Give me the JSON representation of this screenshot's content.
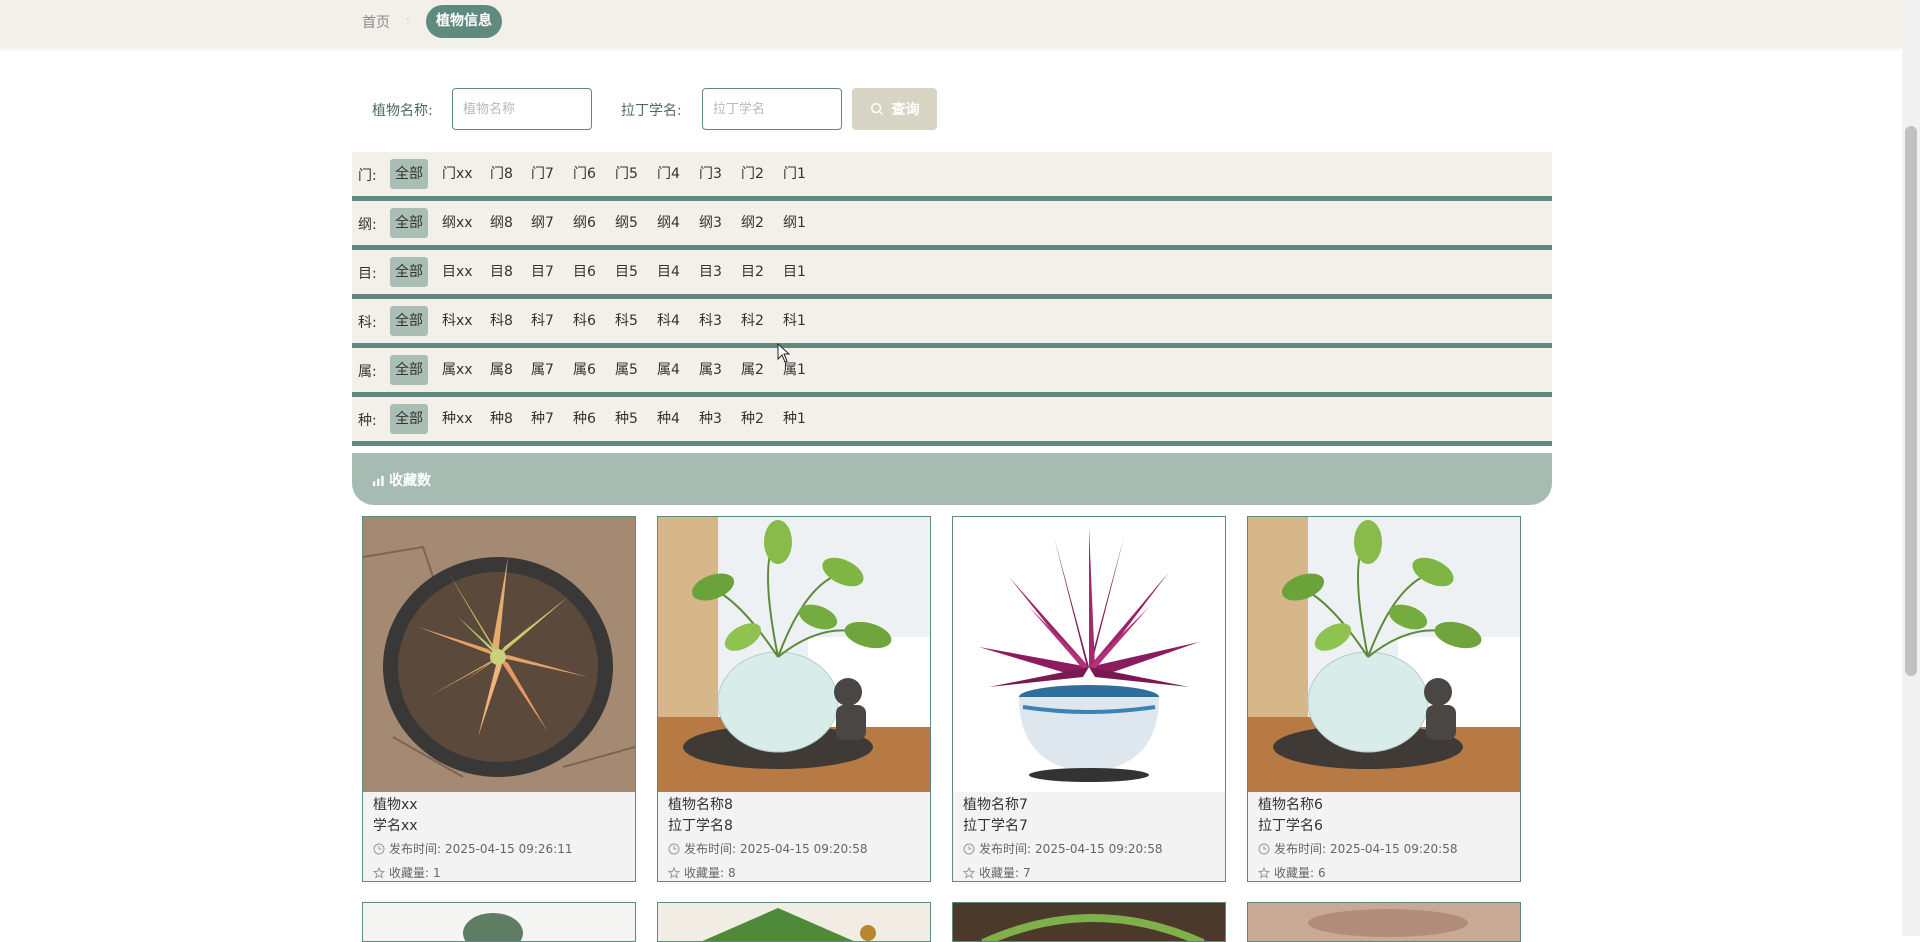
{
  "breadcrumb": {
    "home": "首页",
    "separator": "·",
    "current": "植物信息"
  },
  "search": {
    "name_label": "植物名称:",
    "name_placeholder": "植物名称",
    "latin_label": "拉丁学名:",
    "latin_placeholder": "拉丁学名",
    "query_label": "查询"
  },
  "filters": [
    {
      "label": "门:",
      "options": [
        "全部",
        "门xx",
        "门8",
        "门7",
        "门6",
        "门5",
        "门4",
        "门3",
        "门2",
        "门1"
      ],
      "active": 0
    },
    {
      "label": "纲:",
      "options": [
        "全部",
        "纲xx",
        "纲8",
        "纲7",
        "纲6",
        "纲5",
        "纲4",
        "纲3",
        "纲2",
        "纲1"
      ],
      "active": 0
    },
    {
      "label": "目:",
      "options": [
        "全部",
        "目xx",
        "目8",
        "目7",
        "目6",
        "目5",
        "目4",
        "目3",
        "目2",
        "目1"
      ],
      "active": 0
    },
    {
      "label": "科:",
      "options": [
        "全部",
        "科xx",
        "科8",
        "科7",
        "科6",
        "科5",
        "科4",
        "科3",
        "科2",
        "科1"
      ],
      "active": 0
    },
    {
      "label": "属:",
      "options": [
        "全部",
        "属xx",
        "属8",
        "属7",
        "属6",
        "属5",
        "属4",
        "属3",
        "属2",
        "属1"
      ],
      "active": 0
    },
    {
      "label": "种:",
      "options": [
        "全部",
        "种xx",
        "种8",
        "种7",
        "种6",
        "种5",
        "种4",
        "种3",
        "种2",
        "种1"
      ],
      "active": 0
    }
  ],
  "sort": {
    "label": "收藏数"
  },
  "cards": [
    {
      "name": "植物xx",
      "latin": "学名xx",
      "time_label": "发布时间:",
      "time": "2025-04-15 09:26:11",
      "fav_label": "收藏量:",
      "fav": "1",
      "image": "succulent-photo"
    },
    {
      "name": "植物名称8",
      "latin": "拉丁学名8",
      "time_label": "发布时间:",
      "time": "2025-04-15 09:20:58",
      "fav_label": "收藏量:",
      "fav": "8",
      "image": "pothos-glass-pot-photo"
    },
    {
      "name": "植物名称7",
      "latin": "拉丁学名7",
      "time_label": "发布时间:",
      "time": "2025-04-15 09:20:58",
      "fav_label": "收藏量:",
      "fav": "7",
      "image": "purple-plant-photo"
    },
    {
      "name": "植物名称6",
      "latin": "拉丁学名6",
      "time_label": "发布时间:",
      "time": "2025-04-15 09:20:58",
      "fav_label": "收藏量:",
      "fav": "6",
      "image": "pothos-glass-pot-photo"
    }
  ],
  "colors": {
    "accent": "#5f8a7d",
    "topbar": "#f2f0e9",
    "filter_bg": "#f2f0e9",
    "sort_bar": "#a6bcb3",
    "active_option": "#a9bfb6"
  }
}
